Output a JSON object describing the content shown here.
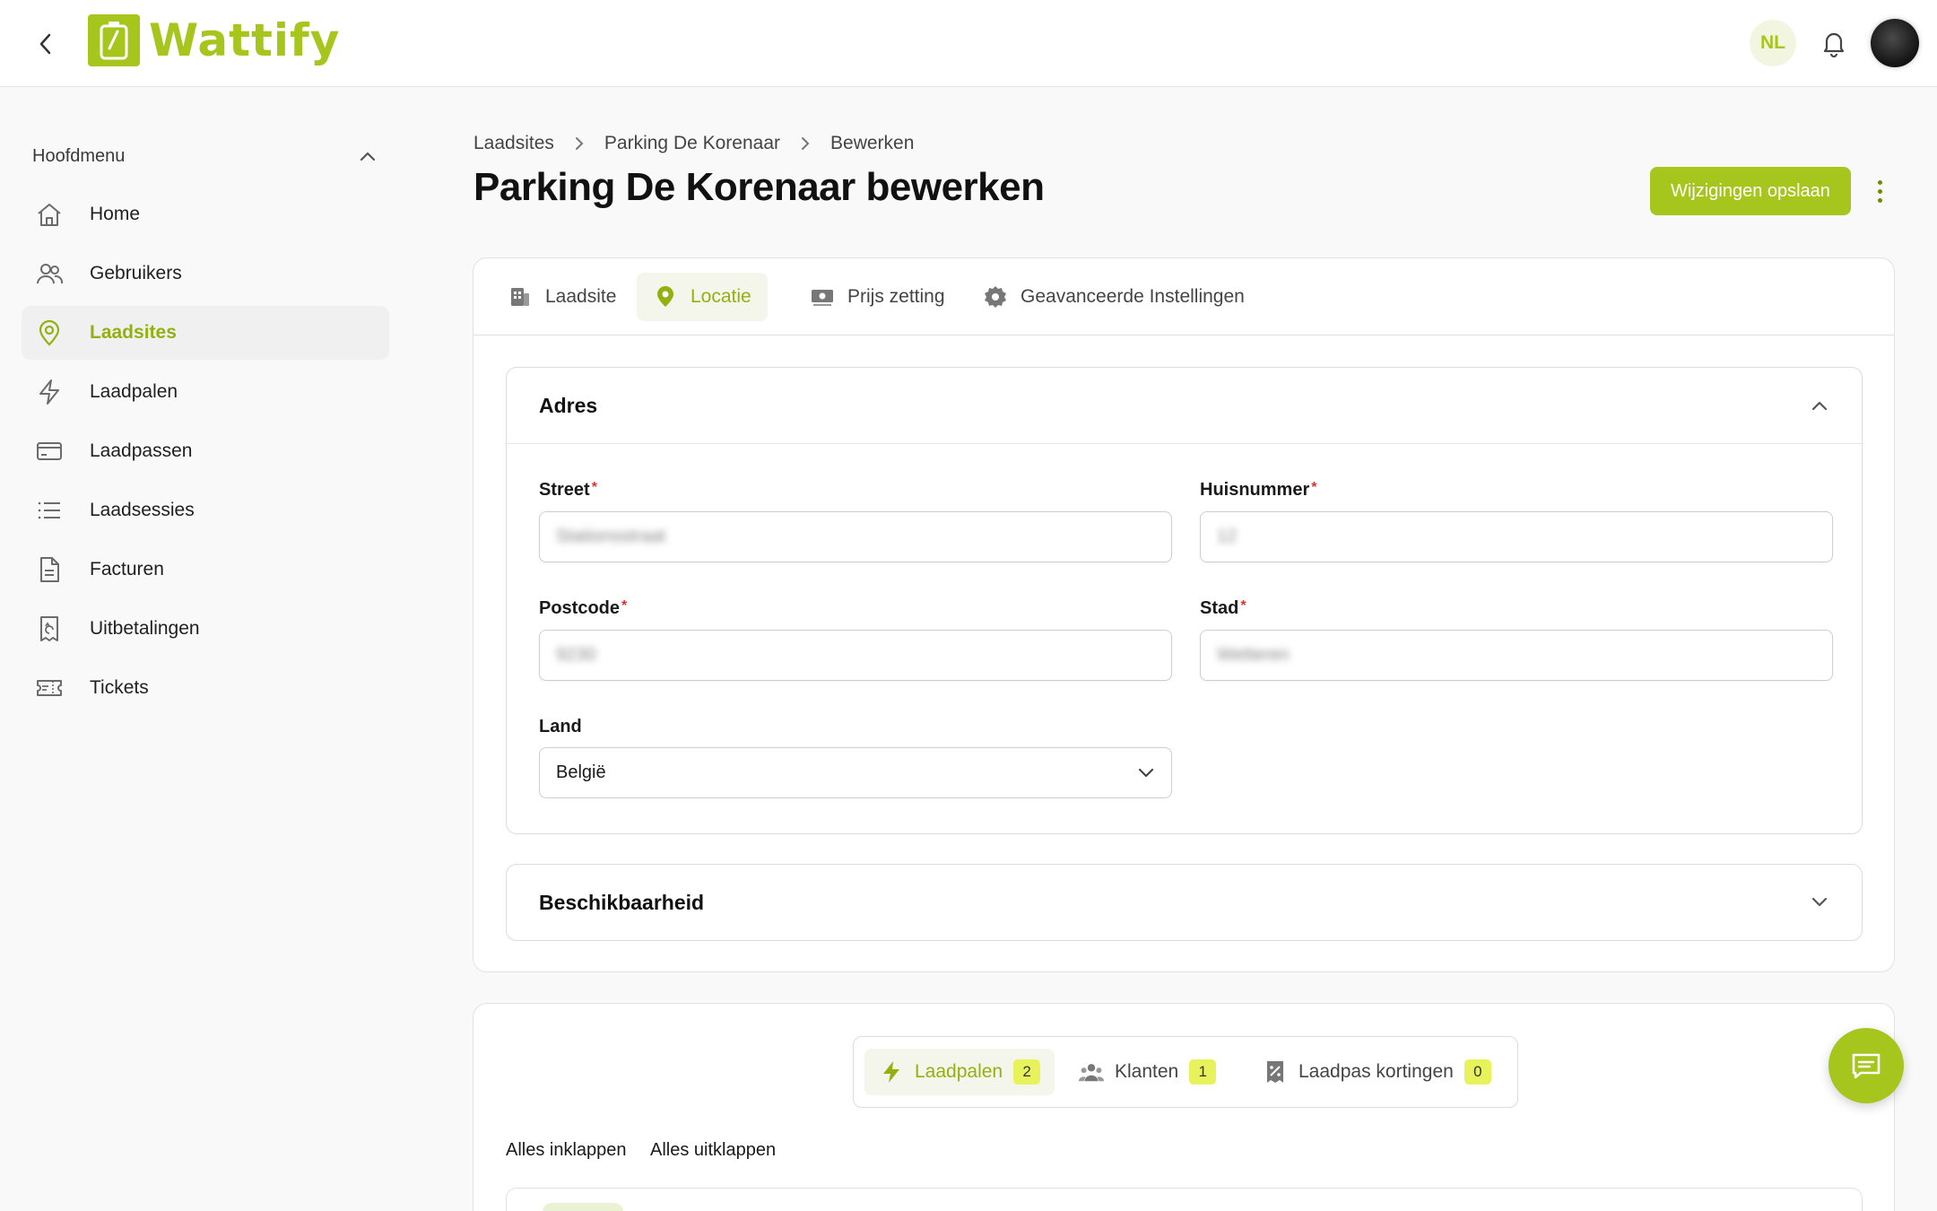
{
  "app": {
    "name": "Wattify",
    "language": "NL"
  },
  "sidebar": {
    "heading": "Hoofdmenu",
    "items": [
      {
        "label": "Home",
        "icon": "home-icon",
        "active": false
      },
      {
        "label": "Gebruikers",
        "icon": "users-icon",
        "active": false
      },
      {
        "label": "Laadsites",
        "icon": "map-pin-icon",
        "active": true
      },
      {
        "label": "Laadpalen",
        "icon": "lightning-icon",
        "active": false
      },
      {
        "label": "Laadpassen",
        "icon": "credit-card-icon",
        "active": false
      },
      {
        "label": "Laadsessies",
        "icon": "list-icon",
        "active": false
      },
      {
        "label": "Facturen",
        "icon": "document-icon",
        "active": false
      },
      {
        "label": "Uitbetalingen",
        "icon": "receipt-refund-icon",
        "active": false
      },
      {
        "label": "Tickets",
        "icon": "ticket-icon",
        "active": false
      }
    ]
  },
  "breadcrumb": [
    "Laadsites",
    "Parking De Korenaar",
    "Bewerken"
  ],
  "page": {
    "title": "Parking De Korenaar bewerken",
    "save_label": "Wijzigingen opslaan"
  },
  "tabs": [
    {
      "label": "Laadsite",
      "icon": "building-icon",
      "active": false
    },
    {
      "label": "Locatie",
      "icon": "location-pin-icon",
      "active": true
    },
    {
      "label": "Prijs zetting",
      "icon": "money-icon",
      "active": false
    },
    {
      "label": "Geavanceerde Instellingen",
      "icon": "gear-icon",
      "active": false
    }
  ],
  "address": {
    "title": "Adres",
    "street_label": "Street",
    "street_value": "Stationsstraat",
    "housenumber_label": "Huisnummer",
    "housenumber_value": "12",
    "postcode_label": "Postcode",
    "postcode_value": "9230",
    "city_label": "Stad",
    "city_value": "Wetteren",
    "country_label": "Land",
    "country_value": "België"
  },
  "availability": {
    "title": "Beschikbaarheid"
  },
  "subtabs": [
    {
      "label": "Laadpalen",
      "count": "2",
      "icon": "lightning-icon",
      "active": true
    },
    {
      "label": "Klanten",
      "count": "1",
      "icon": "people-icon",
      "active": false
    },
    {
      "label": "Laadpas kortingen",
      "count": "0",
      "icon": "discount-icon",
      "active": false
    }
  ],
  "actions": {
    "collapse_all": "Alles inklappen",
    "expand_all": "Alles uitklappen"
  },
  "colors": {
    "accent": "#a6c51d",
    "accent_text": "#93b011",
    "badge": "#e8f25a",
    "required": "#e03131"
  }
}
